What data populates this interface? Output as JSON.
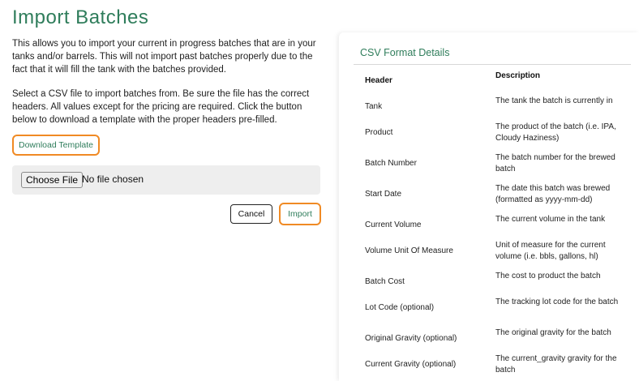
{
  "page": {
    "title": "Import Batches",
    "intro": "This allows you to import your current in progress batches that are in your tanks and/or barrels. This will not import past batches properly due to the fact that it will fill the tank with the batches provided.",
    "instructions": "Select a CSV file to import batches from. Be sure the file has the correct headers. All values except for the pricing are required. Click the button below to download a template with the proper headers pre-filled.",
    "download_template_label": "Download Template",
    "choose_file_label": "Choose File",
    "no_file_text": "No file chosen",
    "cancel_label": "Cancel",
    "import_label": "Import"
  },
  "csv_details": {
    "title": "CSV Format Details",
    "header_col": "Header",
    "description_col": "Description",
    "rows": [
      {
        "header": "Tank",
        "description": "The tank the batch is currently in"
      },
      {
        "header": "Product",
        "description": "The product of the batch (i.e. IPA, Cloudy Haziness)"
      },
      {
        "header": "Batch Number",
        "description": "The batch number for the brewed batch"
      },
      {
        "header": "Start Date",
        "description": "The date this batch was brewed (formatted as yyyy-mm-dd)"
      },
      {
        "header": "Current Volume",
        "description": "The current volume in the tank"
      },
      {
        "header": "Volume Unit Of Measure",
        "description": "Unit of measure for the current volume (i.e. bbls, gallons, hl)"
      },
      {
        "header": "Batch Cost",
        "description": "The cost to product the batch"
      },
      {
        "header": "Lot Code (optional)",
        "description": "The tracking lot code for the batch"
      },
      {
        "header": "Original Gravity (optional)",
        "description": "The original gravity for the batch"
      },
      {
        "header": "Current Gravity (optional)",
        "description": "The current_gravity gravity for the batch"
      }
    ]
  },
  "colors": {
    "accent_green": "#2f7d5b",
    "highlight_orange": "#f08a24"
  }
}
